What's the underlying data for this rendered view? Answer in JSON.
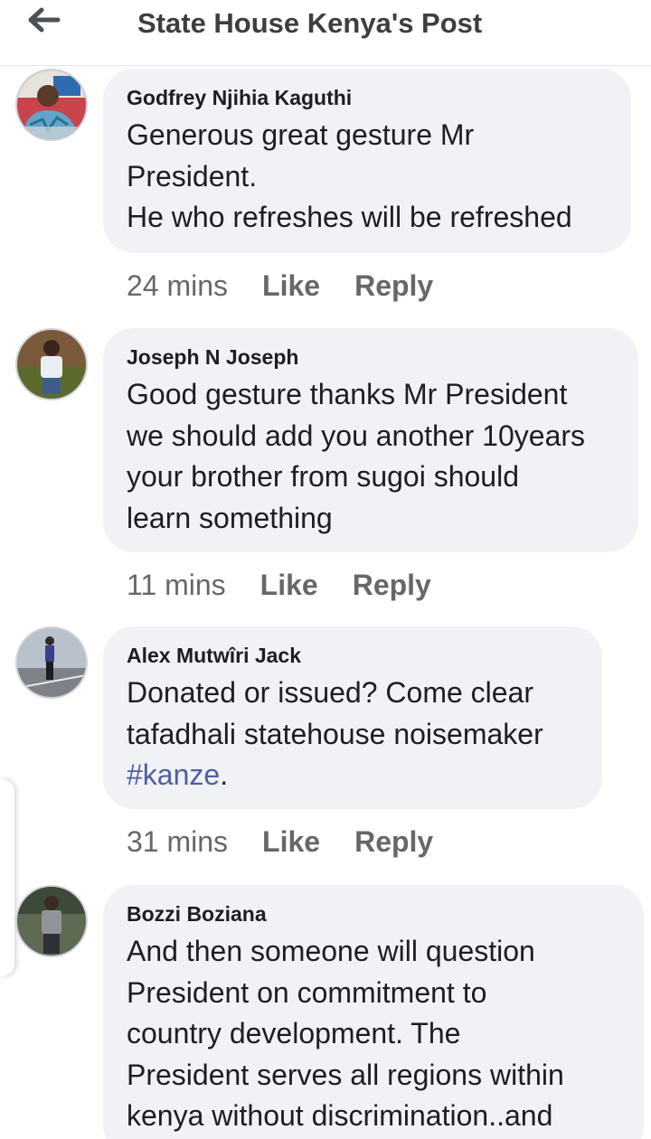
{
  "header": {
    "title": "State House Kenya's Post",
    "back_icon": "arrow-left-icon"
  },
  "colors": {
    "bubble_bg": "#f0f2f5",
    "meta_text": "#65676b",
    "hashtag": "#4d5fa3",
    "title_text": "#3c3e42"
  },
  "comments": [
    {
      "author": "Godfrey Njihia Kaguthi",
      "lines": [
        "Generous great gesture Mr",
        "President.",
        "He who refreshes will be refreshed"
      ],
      "time": "24 mins",
      "like": "Like",
      "reply": "Reply"
    },
    {
      "author": "Joseph N Joseph",
      "lines": [
        "Good gesture thanks Mr President",
        "we should add you another 10years",
        "your brother from sugoi should",
        "learn something"
      ],
      "time": "11 mins",
      "like": "Like",
      "reply": "Reply"
    },
    {
      "author": "Alex Mutwîri Jack",
      "lines": [
        "Donated or issued? Come clear",
        "tafadhali statehouse noisemaker"
      ],
      "hashtag": "#kanze",
      "hashtag_suffix": ".",
      "time": "31 mins",
      "like": "Like",
      "reply": "Reply"
    },
    {
      "author": "Bozzi Boziana",
      "lines": [
        "And then someone will question",
        "President on commitment to",
        "country development.  The",
        "President serves all regions within",
        "kenya without discrimination..and"
      ]
    }
  ]
}
